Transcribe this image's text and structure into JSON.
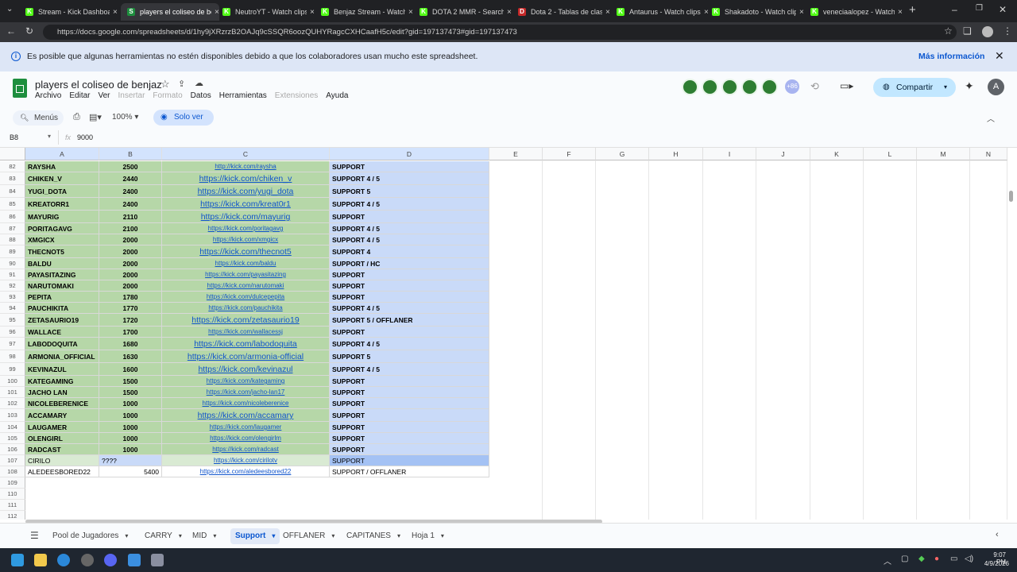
{
  "browser": {
    "tabs": [
      {
        "title": "Stream - Kick Dashboar",
        "color": "#53fc18",
        "letter": "K"
      },
      {
        "title": "players el coliseo de ben",
        "color": "#1e8e3e",
        "letter": "S"
      },
      {
        "title": "NeutroYT - Watch clips",
        "color": "#53fc18",
        "letter": "K"
      },
      {
        "title": "Benjaz Stream - Watch l",
        "color": "#53fc18",
        "letter": "K"
      },
      {
        "title": "DOTA 2 MMR - Search",
        "color": "#53fc18",
        "letter": "K"
      },
      {
        "title": "Dota 2 - Tablas de clasif",
        "color": "#c62828",
        "letter": "D"
      },
      {
        "title": "Antaurus - Watch clips c",
        "color": "#53fc18",
        "letter": "K"
      },
      {
        "title": "Shakadoto - Watch clip",
        "color": "#53fc18",
        "letter": "K"
      },
      {
        "title": "veneciaalopez - Watch",
        "color": "#53fc18",
        "letter": "K"
      }
    ],
    "url": "https://docs.google.com/spreadsheets/d/1hy9jXRzrzB2OAJq9cSSQR6oozQUHYRagcCXHCaafH5c/edit?gid=197137473#gid=197137473"
  },
  "banner": {
    "message": "Es posible que algunas herramientas no estén disponibles debido a que los colaboradores usan mucho este spreadsheet.",
    "link": "Más información"
  },
  "doc": {
    "title": "players el coliseo de benjaz",
    "menus": [
      "Archivo",
      "Editar",
      "Ver",
      "Insertar",
      "Formato",
      "Datos",
      "Herramientas",
      "Extensiones",
      "Ayuda"
    ],
    "collaborators_extra": "+86",
    "share": "Compartir",
    "avatar": "A"
  },
  "toolbar": {
    "menus_label": "Menús",
    "zoom": "100%",
    "view_only": "Solo ver"
  },
  "formula": {
    "cell_ref": "B8",
    "fx": "fx",
    "value": "9000"
  },
  "columns": [
    "A",
    "B",
    "C",
    "D",
    "E",
    "F",
    "G",
    "H",
    "I",
    "J",
    "K",
    "L",
    "M",
    "N"
  ],
  "rows": [
    {
      "n": "82",
      "name": "RAYSHA",
      "mmr": "2500",
      "link": "http://kick.com/raysha",
      "role": "SUPPORT",
      "big": false
    },
    {
      "n": "83",
      "name": "CHIKEN_V",
      "mmr": "2440",
      "link": "https://kick.com/chiken_v",
      "role": "SUPPORT 4 / 5",
      "big": true
    },
    {
      "n": "84",
      "name": "YUGI_DOTA",
      "mmr": "2400",
      "link": "https://kick.com/yugi_dota",
      "role": "SUPPORT 5",
      "big": true
    },
    {
      "n": "85",
      "name": "KREATORR1",
      "mmr": "2400",
      "link": "https://kick.com/kreat0r1",
      "role": "SUPPORT 4 / 5",
      "big": true
    },
    {
      "n": "86",
      "name": "MAYURIG",
      "mmr": "2110",
      "link": "https://kick.com/mayurig",
      "role": "SUPPORT",
      "big": true
    },
    {
      "n": "87",
      "name": "PORITAGAVG",
      "mmr": "2100",
      "link": "https://kick.com/poritagavg",
      "role": "SUPPORT 4 / 5",
      "big": false
    },
    {
      "n": "88",
      "name": "XMGICX",
      "mmr": "2000",
      "link": "https://kick.com/xmgicx",
      "role": "SUPPORT 4 / 5",
      "big": false
    },
    {
      "n": "89",
      "name": "THECNOT5",
      "mmr": "2000",
      "link": "https://kick.com/thecnot5",
      "role": "SUPPORT 4",
      "big": true
    },
    {
      "n": "90",
      "name": "BALDU",
      "mmr": "2000",
      "link": "https://kick.com/baldu",
      "role": "SUPPORT / HC",
      "big": false
    },
    {
      "n": "91",
      "name": "PAYASITAZING",
      "mmr": "2000",
      "link": "https://kick.com/payasitazing",
      "role": "SUPPORT",
      "big": false
    },
    {
      "n": "92",
      "name": "NARUTOMAKI",
      "mmr": "2000",
      "link": "https://kick.com/narutomaki",
      "role": "SUPPORT",
      "big": false
    },
    {
      "n": "93",
      "name": "PEPITA",
      "mmr": "1780",
      "link": "https://kick.com/dulcepepita",
      "role": "SUPPORT",
      "big": false
    },
    {
      "n": "94",
      "name": "PAUCHIKITA",
      "mmr": "1770",
      "link": "https://kick.com/pauchikita",
      "role": "SUPPORT 4 / 5",
      "big": false
    },
    {
      "n": "95",
      "name": "ZETASAURIO19",
      "mmr": "1720",
      "link": "https://kick.com/zetasaurio19",
      "role": "SUPPORT 5 / OFFLANER",
      "big": true
    },
    {
      "n": "96",
      "name": "WALLACE",
      "mmr": "1700",
      "link": "https://kick.com/wallacessj",
      "role": "SUPPORT",
      "big": false
    },
    {
      "n": "97",
      "name": "LABODOQUITA",
      "mmr": "1680",
      "link": "https://kick.com/labodoquita",
      "role": "SUPPORT 4 / 5",
      "big": true
    },
    {
      "n": "98",
      "name": "ARMONIA_OFFICIAL",
      "mmr": "1630",
      "link": "https://kick.com/armonia-official",
      "role": "SUPPORT 5",
      "big": true
    },
    {
      "n": "99",
      "name": "KEVINAZUL",
      "mmr": "1600",
      "link": "https://kick.com/kevinazul",
      "role": "SUPPORT 4 / 5",
      "big": true
    },
    {
      "n": "100",
      "name": "KATEGAMING",
      "mmr": "1500",
      "link": "https://kick.com/kategaming",
      "role": "SUPPORT",
      "big": false
    },
    {
      "n": "101",
      "name": "JACHO LAN",
      "mmr": "1500",
      "link": "https://kick.com/jacho-lan17",
      "role": "SUPPORT",
      "big": false
    },
    {
      "n": "102",
      "name": "NICOLEBERENICE",
      "mmr": "1000",
      "link": "https://kick.com/nicoleberenice",
      "role": "SUPPORT",
      "big": false
    },
    {
      "n": "103",
      "name": "ACCAMARY",
      "mmr": "1000",
      "link": "https://kick.com/accamary",
      "role": "SUPPORT",
      "big": true
    },
    {
      "n": "104",
      "name": "LAUGAMER",
      "mmr": "1000",
      "link": "https://kick.com/laugamer",
      "role": "SUPPORT",
      "big": false
    },
    {
      "n": "105",
      "name": "OLENGIRL",
      "mmr": "1000",
      "link": "https://kick.com/olengirlm",
      "role": "SUPPORT",
      "big": false
    },
    {
      "n": "106",
      "name": "RADCAST",
      "mmr": "1000",
      "link": "https://kick.com/radcast",
      "role": "SUPPORT",
      "big": false
    },
    {
      "n": "107",
      "name": "CIRILO",
      "mmr": "????",
      "link": "https://kick.com/cirilotv",
      "role": "SUPPORT",
      "big": false,
      "style": "cirilo"
    },
    {
      "n": "108",
      "name": "ALEDEESBORED22",
      "mmr": "5400",
      "link": "https://kick.com/aledeesbored22",
      "role": "SUPPORT / OFFLANER",
      "big": false,
      "style": "plain"
    }
  ],
  "empty_rows": [
    "109",
    "110",
    "111",
    "112"
  ],
  "sheet_tabs": [
    "Pool de Jugadores",
    "CARRY",
    "MID",
    "Support",
    "OFFLANER",
    "CAPITANES",
    "Hoja 1"
  ],
  "active_sheet": "Support",
  "colors": {
    "green": "#b6d7a8",
    "blue": "#c9daf8",
    "sheets_green": "#1e8e3e",
    "cirilo_b": "#c9daf8",
    "cirilo_d": "#a4c2f4"
  },
  "clock": {
    "time": "9:07 PM",
    "date": "4/9/2026"
  }
}
